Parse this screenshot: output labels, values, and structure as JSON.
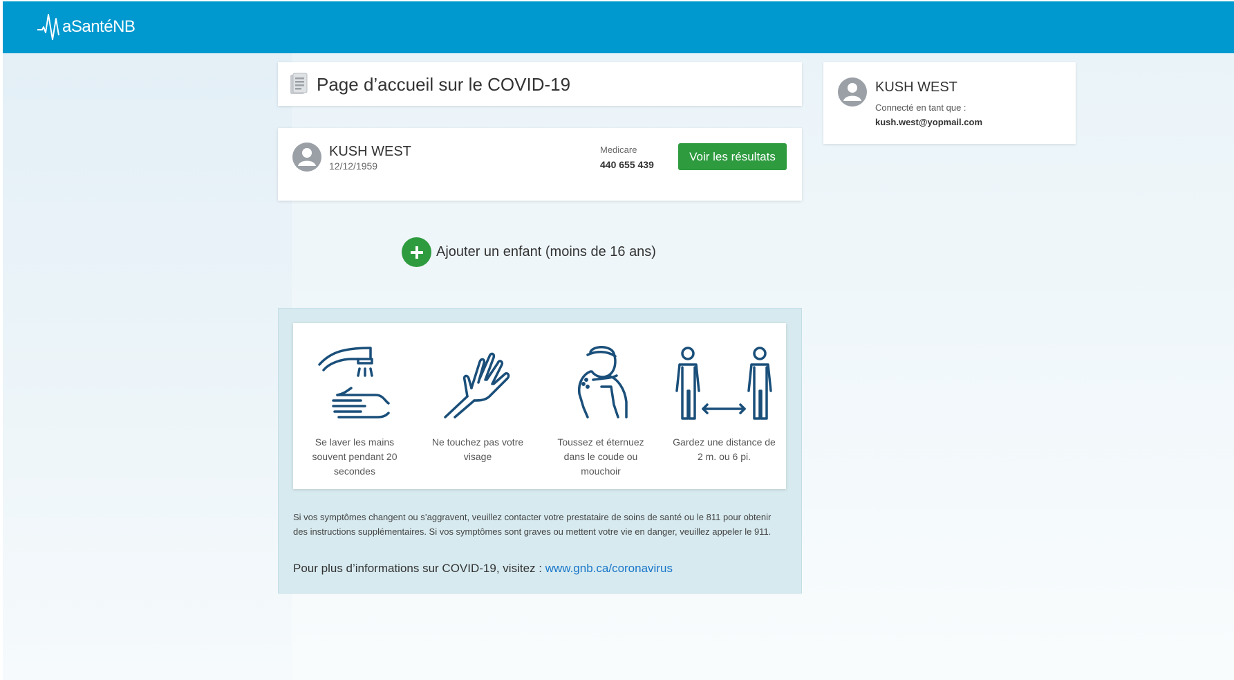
{
  "header": {
    "logo_text": "aSantéNB",
    "logo_icon": "heartbeat-m-icon"
  },
  "page": {
    "title": "Page d’accueil sur le COVID-19",
    "title_icon": "document-icon"
  },
  "patient": {
    "name": "KUSH WEST",
    "dob": "12/12/1959",
    "medicare_label": "Medicare",
    "medicare_number": "440 655 439",
    "results_button": "Voir les résultats"
  },
  "add_child": {
    "label": "Ajouter un enfant (moins de 16 ans)",
    "icon": "plus-circle-icon"
  },
  "tips": [
    {
      "icon": "hand-washing-icon",
      "text": "Se laver les mains souvent pendant 20 secondes"
    },
    {
      "icon": "no-touch-face-icon",
      "text": "Ne touchez pas votre visage"
    },
    {
      "icon": "cough-elbow-icon",
      "text": "Toussez et éternuez dans le coude ou mouchoir"
    },
    {
      "icon": "social-distance-icon",
      "text": "Gardez une distance de 2 m. ou 6 pi."
    }
  ],
  "info": {
    "symptoms_text": "Si vos symptômes changent ou s’aggravent, veuillez contacter votre prestataire de soins de santé ou le 811 pour obtenir des instructions supplémentaires. Si vos symptômes sont graves ou mettent votre vie en danger, veuillez appeler le 911.",
    "more_info_prefix": "Pour plus d’informations sur COVID-19, visitez : ",
    "more_info_link": "www.gnb.ca/coronavirus"
  },
  "user": {
    "name": "KUSH WEST",
    "connected_label": "Connecté en tant que :",
    "email": "kush.west@yopmail.com"
  },
  "colors": {
    "header_bg": "#0099cf",
    "button_green": "#2e9b3f",
    "link_blue": "#1976c9",
    "panel_bg": "#d7eaef",
    "icon_blue": "#1a4f7a"
  }
}
